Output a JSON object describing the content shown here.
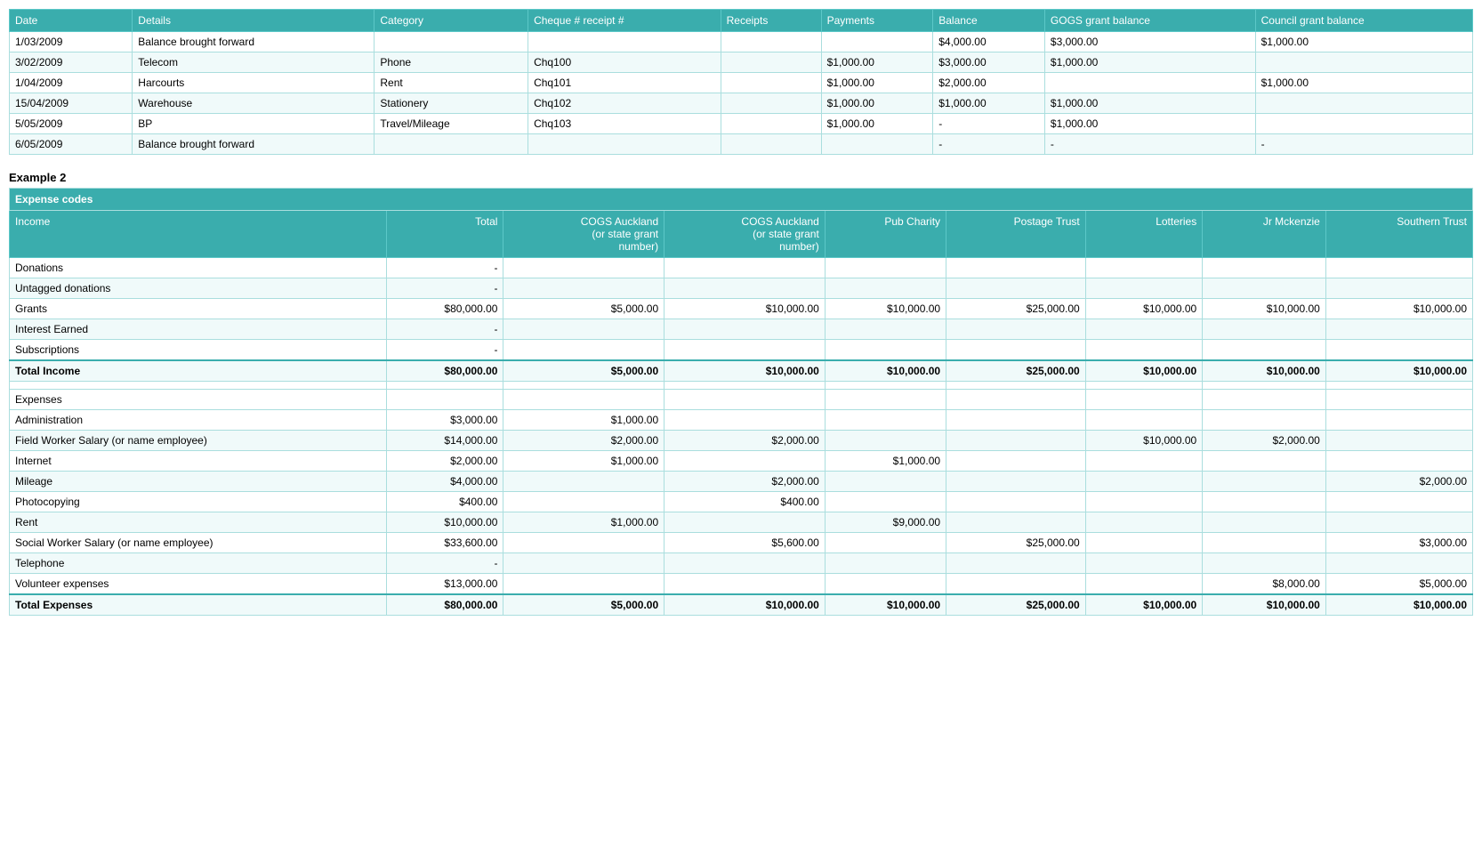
{
  "table1": {
    "headers": [
      "Date",
      "Details",
      "Category",
      "Cheque # receipt #",
      "Receipts",
      "Payments",
      "Balance",
      "GOGS grant balance",
      "Council grant balance"
    ],
    "rows": [
      {
        "date": "1/03/2009",
        "details": "Balance brought forward",
        "category": "",
        "cheque": "",
        "receipts": "",
        "payments": "",
        "balance": "$4,000.00",
        "gogs": "$3,000.00",
        "council": "$1,000.00"
      },
      {
        "date": "3/02/2009",
        "details": "Telecom",
        "category": "Phone",
        "cheque": "Chq100",
        "receipts": "",
        "payments": "$1,000.00",
        "balance": "$3,000.00",
        "gogs": "$1,000.00",
        "council": ""
      },
      {
        "date": "1/04/2009",
        "details": "Harcourts",
        "category": "Rent",
        "cheque": "Chq101",
        "receipts": "",
        "payments": "$1,000.00",
        "balance": "$2,000.00",
        "gogs": "",
        "council": "$1,000.00"
      },
      {
        "date": "15/04/2009",
        "details": "Warehouse",
        "category": "Stationery",
        "cheque": "Chq102",
        "receipts": "",
        "payments": "$1,000.00",
        "balance": "$1,000.00",
        "gogs": "$1,000.00",
        "council": ""
      },
      {
        "date": "5/05/2009",
        "details": "BP",
        "category": "Travel/Mileage",
        "cheque": "Chq103",
        "receipts": "",
        "payments": "$1,000.00",
        "balance": "-",
        "gogs": "$1,000.00",
        "council": ""
      },
      {
        "date": "6/05/2009",
        "details": "Balance brought forward",
        "category": "",
        "cheque": "",
        "receipts": "",
        "payments": "",
        "balance": "-",
        "gogs": "-",
        "council": "-"
      }
    ]
  },
  "example2": {
    "title": "Example 2",
    "expenseCodesLabel": "Expense codes",
    "headers": [
      "Income",
      "Total",
      "COGS Auckland (or state grant number)",
      "COGS Auckland (or state grant number)",
      "Pub Charity",
      "Postage Trust",
      "Lotteries",
      "Jr Mckenzie",
      "Southern Trust"
    ],
    "incomeRows": [
      {
        "label": "Donations",
        "total": "-",
        "c1": "",
        "c2": "",
        "c3": "",
        "c4": "",
        "c5": "",
        "c6": "",
        "c7": ""
      },
      {
        "label": "Untagged donations",
        "total": "-",
        "c1": "",
        "c2": "",
        "c3": "",
        "c4": "",
        "c5": "",
        "c6": "",
        "c7": ""
      },
      {
        "label": "Grants",
        "total": "$80,000.00",
        "c1": "$5,000.00",
        "c2": "$10,000.00",
        "c3": "$10,000.00",
        "c4": "$25,000.00",
        "c5": "$10,000.00",
        "c6": "$10,000.00",
        "c7": "$10,000.00"
      },
      {
        "label": "Interest Earned",
        "total": "-",
        "c1": "",
        "c2": "",
        "c3": "",
        "c4": "",
        "c5": "",
        "c6": "",
        "c7": ""
      },
      {
        "label": "Subscriptions",
        "total": "-",
        "c1": "",
        "c2": "",
        "c3": "",
        "c4": "",
        "c5": "",
        "c6": "",
        "c7": ""
      }
    ],
    "totalIncomeRow": {
      "label": "Total Income",
      "total": "$80,000.00",
      "c1": "$5,000.00",
      "c2": "$10,000.00",
      "c3": "$10,000.00",
      "c4": "$25,000.00",
      "c5": "$10,000.00",
      "c6": "$10,000.00",
      "c7": "$10,000.00"
    },
    "expenseSectionLabel": "Expenses",
    "expenseRows": [
      {
        "label": "Administration",
        "total": "$3,000.00",
        "c1": "$1,000.00",
        "c2": "",
        "c3": "",
        "c4": "",
        "c5": "",
        "c6": "",
        "c7": ""
      },
      {
        "label": "Field Worker Salary (or name employee)",
        "total": "$14,000.00",
        "c1": "$2,000.00",
        "c2": "$2,000.00",
        "c3": "",
        "c4": "",
        "c5": "$10,000.00",
        "c6": "$2,000.00",
        "c7": ""
      },
      {
        "label": "Internet",
        "total": "$2,000.00",
        "c1": "$1,000.00",
        "c2": "",
        "c3": "$1,000.00",
        "c4": "",
        "c5": "",
        "c6": "",
        "c7": ""
      },
      {
        "label": "Mileage",
        "total": "$4,000.00",
        "c1": "",
        "c2": "$2,000.00",
        "c3": "",
        "c4": "",
        "c5": "",
        "c6": "",
        "c7": "$2,000.00"
      },
      {
        "label": "Photocopying",
        "total": "$400.00",
        "c1": "",
        "c2": "$400.00",
        "c3": "",
        "c4": "",
        "c5": "",
        "c6": "",
        "c7": ""
      },
      {
        "label": "Rent",
        "total": "$10,000.00",
        "c1": "$1,000.00",
        "c2": "",
        "c3": "$9,000.00",
        "c4": "",
        "c5": "",
        "c6": "",
        "c7": ""
      },
      {
        "label": "Social Worker Salary (or name employee)",
        "total": "$33,600.00",
        "c1": "",
        "c2": "$5,600.00",
        "c3": "",
        "c4": "$25,000.00",
        "c5": "",
        "c6": "",
        "c7": "$3,000.00"
      },
      {
        "label": "Telephone",
        "total": "-",
        "c1": "",
        "c2": "",
        "c3": "",
        "c4": "",
        "c5": "",
        "c6": "",
        "c7": ""
      },
      {
        "label": "Volunteer expenses",
        "total": "$13,000.00",
        "c1": "",
        "c2": "",
        "c3": "",
        "c4": "",
        "c5": "",
        "c6": "$8,000.00",
        "c7": "$5,000.00"
      }
    ],
    "totalExpensesRow": {
      "label": "Total Expenses",
      "total": "$80,000.00",
      "c1": "$5,000.00",
      "c2": "$10,000.00",
      "c3": "$10,000.00",
      "c4": "$25,000.00",
      "c5": "$10,000.00",
      "c6": "$10,000.00",
      "c7": "$10,000.00"
    }
  }
}
